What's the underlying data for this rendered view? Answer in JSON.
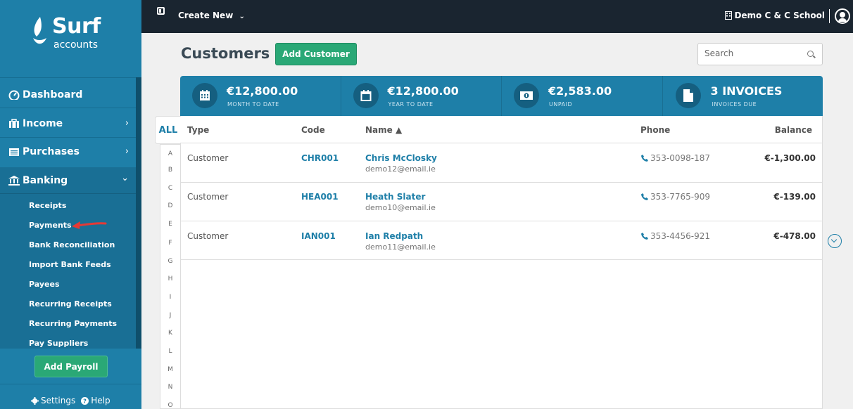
{
  "app": {
    "logo_main": "Surf",
    "logo_sub": "accounts",
    "brand_color": "#1e7fa8",
    "accent_green": "#2aa876"
  },
  "sidebar": {
    "main_items": [
      {
        "label": "Dashboard",
        "icon": "dashboard-icon"
      },
      {
        "label": "Income",
        "icon": "income-icon",
        "chevron": "›"
      },
      {
        "label": "Purchases",
        "icon": "purchases-icon",
        "chevron": "›"
      },
      {
        "label": "Banking",
        "icon": "bank-icon",
        "chevron": "⌄"
      }
    ],
    "banking_items": [
      "Receipts",
      "Payments",
      "Bank Reconciliation",
      "Import Bank Feeds",
      "Payees",
      "Recurring Receipts",
      "Recurring Payments",
      "Pay Suppliers"
    ],
    "add_payroll": "Add Payroll",
    "settings": "Settings",
    "help": "Help"
  },
  "topbar": {
    "create_new": "Create New",
    "company": "Demo C & C School"
  },
  "page": {
    "title": "Customers",
    "add_button": "Add Customer",
    "search_placeholder": "Search"
  },
  "stats": [
    {
      "value": "€12,800.00",
      "label": "MONTH TO DATE",
      "icon": "calendar-grid-icon"
    },
    {
      "value": "€12,800.00",
      "label": "YEAR TO DATE",
      "icon": "calendar-icon"
    },
    {
      "value": "€2,583.00",
      "label": "UNPAID",
      "icon": "banknote-icon"
    },
    {
      "value": "3 INVOICES",
      "label": "INVOICES DUE",
      "icon": "document-icon"
    }
  ],
  "alphabet": {
    "all": "ALL",
    "letters": [
      "A",
      "B",
      "C",
      "D",
      "E",
      "F",
      "G",
      "H",
      "I",
      "J",
      "K",
      "L",
      "M",
      "N",
      "O"
    ]
  },
  "table": {
    "headers": {
      "type": "Type",
      "code": "Code",
      "name": "Name ▲",
      "phone": "Phone",
      "balance": "Balance"
    },
    "rows": [
      {
        "type": "Customer",
        "code": "CHR001",
        "name": "Chris McClosky",
        "email": "demo12@email.ie",
        "phone": "353-0098-187",
        "balance": "€-1,300.00"
      },
      {
        "type": "Customer",
        "code": "HEA001",
        "name": "Heath Slater",
        "email": "demo10@email.ie",
        "phone": "353-7765-909",
        "balance": "€-139.00"
      },
      {
        "type": "Customer",
        "code": "IAN001",
        "name": "Ian Redpath",
        "email": "demo11@email.ie",
        "phone": "353-4456-921",
        "balance": "€-478.00"
      }
    ]
  }
}
